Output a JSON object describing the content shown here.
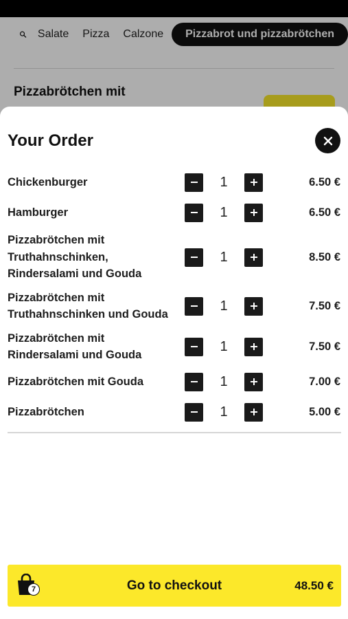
{
  "background": {
    "nav": {
      "search_icon": "search-icon",
      "categories": [
        "Salate",
        "Pizza",
        "Calzone"
      ],
      "active_category": "Pizzabrot und pizzabrötchen"
    },
    "section_title": "Pizzabrötchen mit"
  },
  "order": {
    "title": "Your Order",
    "close_icon": "close-icon",
    "items": [
      {
        "name": "Chickenburger",
        "qty": "1",
        "price": "6.50 €"
      },
      {
        "name": "Hamburger",
        "qty": "1",
        "price": "6.50 €"
      },
      {
        "name": "Pizzabrötchen mit Truthahnschinken, Rindersalami und Gouda",
        "qty": "1",
        "price": "8.50 €"
      },
      {
        "name": "Pizzabrötchen mit Truthahnschinken und Gouda",
        "qty": "1",
        "price": "7.50 €"
      },
      {
        "name": "Pizzabrötchen mit Rindersalami und Gouda",
        "qty": "1",
        "price": "7.50 €"
      },
      {
        "name": "Pizzabrötchen mit Gouda",
        "qty": "1",
        "price": "7.00 €"
      },
      {
        "name": "Pizzabrötchen",
        "qty": "1",
        "price": "5.00 €"
      }
    ]
  },
  "checkout": {
    "label": "Go to checkout",
    "total": "48.50 €",
    "bag_count": "7",
    "bag_icon": "shopping-bag-icon"
  },
  "colors": {
    "accent": "#fce82a",
    "dark": "#111111"
  }
}
